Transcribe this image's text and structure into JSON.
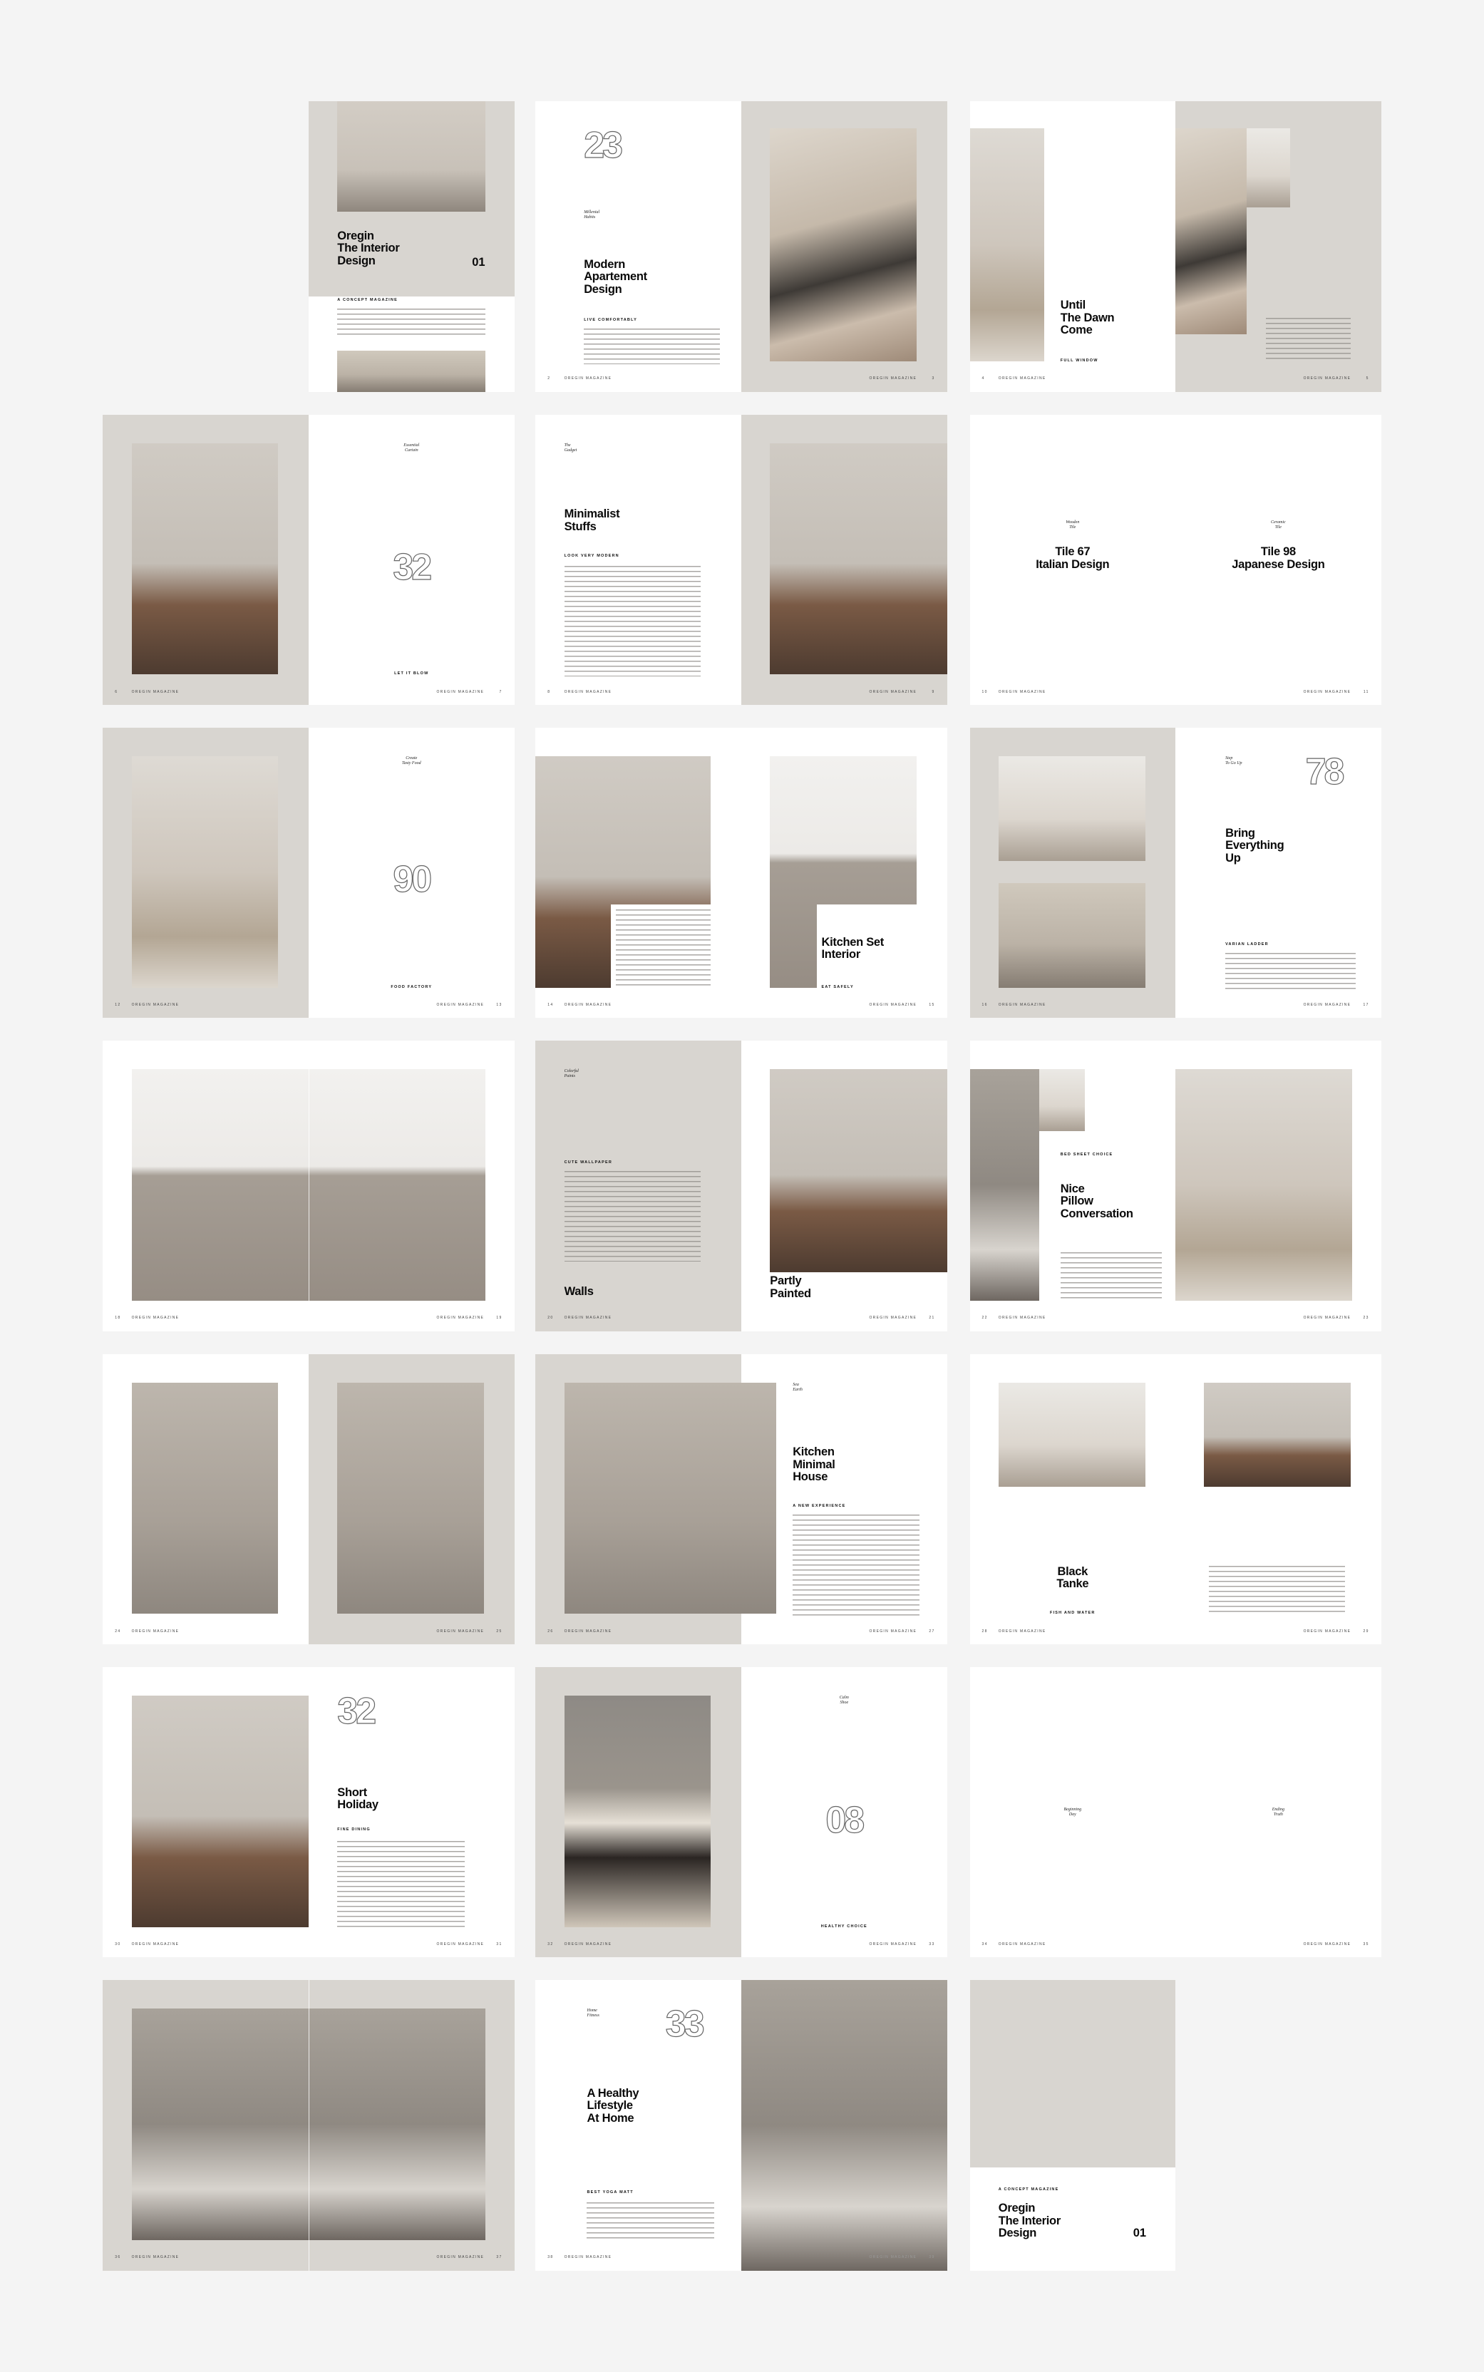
{
  "colors": {
    "background": "#f4f4f4",
    "page_gray": "#d8d5d0",
    "page_white": "#ffffff",
    "text": "#0a0a0a"
  },
  "footer_brand": "OREGIN MAGAZINE",
  "pages": {
    "1": {
      "title": "Oregin\nThe Interior\nDesign",
      "issue": "01",
      "kicker": "A CONCEPT MAGAZINE"
    },
    "2": {
      "page": "2",
      "number": "23",
      "italic": "Millenial\nHabits",
      "title": "Modern\nApartement\nDesign",
      "kicker": "LIVE COMFORTABLY"
    },
    "3": {
      "page": "3"
    },
    "4": {
      "page": "4",
      "title": "Until\nThe Dawn\nCome",
      "kicker": "FULL WINDOW"
    },
    "5": {
      "page": "5"
    },
    "6": {
      "page": "6"
    },
    "7": {
      "page": "7",
      "italic": "Essential\nCurtain",
      "number": "32",
      "kicker": "LET IT BLOW"
    },
    "8": {
      "page": "8",
      "italic": "The\nGadget",
      "title": "Minimalist\nStuffs",
      "kicker": "LOOK VERY MODERN"
    },
    "9": {
      "page": "9"
    },
    "10": {
      "page": "10",
      "italic": "Wooden\nTile",
      "title": "Tile 67\nItalian Design"
    },
    "11": {
      "page": "11",
      "italic": "Ceramic\nTile",
      "title": "Tile 98\nJapanese Design"
    },
    "12": {
      "page": "12"
    },
    "13": {
      "page": "13",
      "italic": "Create\nTasty Food",
      "number": "90",
      "kicker": "FOOD FACTORY"
    },
    "14": {
      "page": "14"
    },
    "15": {
      "page": "15",
      "title": "Kitchen Set\nInterior",
      "kicker": "EAT SAFELY"
    },
    "16": {
      "page": "16"
    },
    "17": {
      "page": "17",
      "italic": "Step\nTo Go Up",
      "number": "78",
      "title": "Bring\nEverything\nUp",
      "kicker": "VARIAN LADDER"
    },
    "18": {
      "page": "18"
    },
    "19": {
      "page": "19"
    },
    "20": {
      "page": "20",
      "italic": "Colorful\nPaints",
      "kicker": "CUTE WALLPAPER",
      "title": "Walls"
    },
    "21": {
      "page": "21",
      "title": "Partly\nPainted"
    },
    "22": {
      "page": "22",
      "kicker": "BED SHEET CHOICE",
      "title": "Nice\nPillow\nConversation"
    },
    "23": {
      "page": "23"
    },
    "24": {
      "page": "24"
    },
    "25": {
      "page": "25"
    },
    "26": {
      "page": "26"
    },
    "27": {
      "page": "27",
      "italic": "Sea\nEarth",
      "title": "Kitchen\nMinimal\nHouse",
      "kicker": "A NEW EXPERIENCE"
    },
    "28": {
      "page": "28",
      "title": "Black\nTanke",
      "kicker": "FISH AND WATER"
    },
    "29": {
      "page": "29"
    },
    "30": {
      "page": "30"
    },
    "31": {
      "page": "31",
      "number": "32",
      "title": "Short\nHoliday",
      "kicker": "FINE DINING"
    },
    "32": {
      "page": "32"
    },
    "33": {
      "page": "33",
      "italic": "Calm\nShoe",
      "number": "08",
      "kicker": "HEALTHY CHOICE"
    },
    "34": {
      "page": "34",
      "italic": "Beginning\nDay"
    },
    "35": {
      "page": "35",
      "italic": "Ending\nTruth"
    },
    "36": {
      "page": "36"
    },
    "37": {
      "page": "37"
    },
    "38": {
      "page": "38",
      "italic": "Home\nFitness",
      "number": "33",
      "title": "A Healthy\nLifestyle\nAt Home",
      "kicker": "BEST YOGA MATT"
    },
    "39": {
      "page": "39"
    },
    "back": {
      "kicker": "A CONCEPT MAGAZINE",
      "title": "Oregin\nThe Interior\nDesign",
      "issue": "01"
    }
  }
}
